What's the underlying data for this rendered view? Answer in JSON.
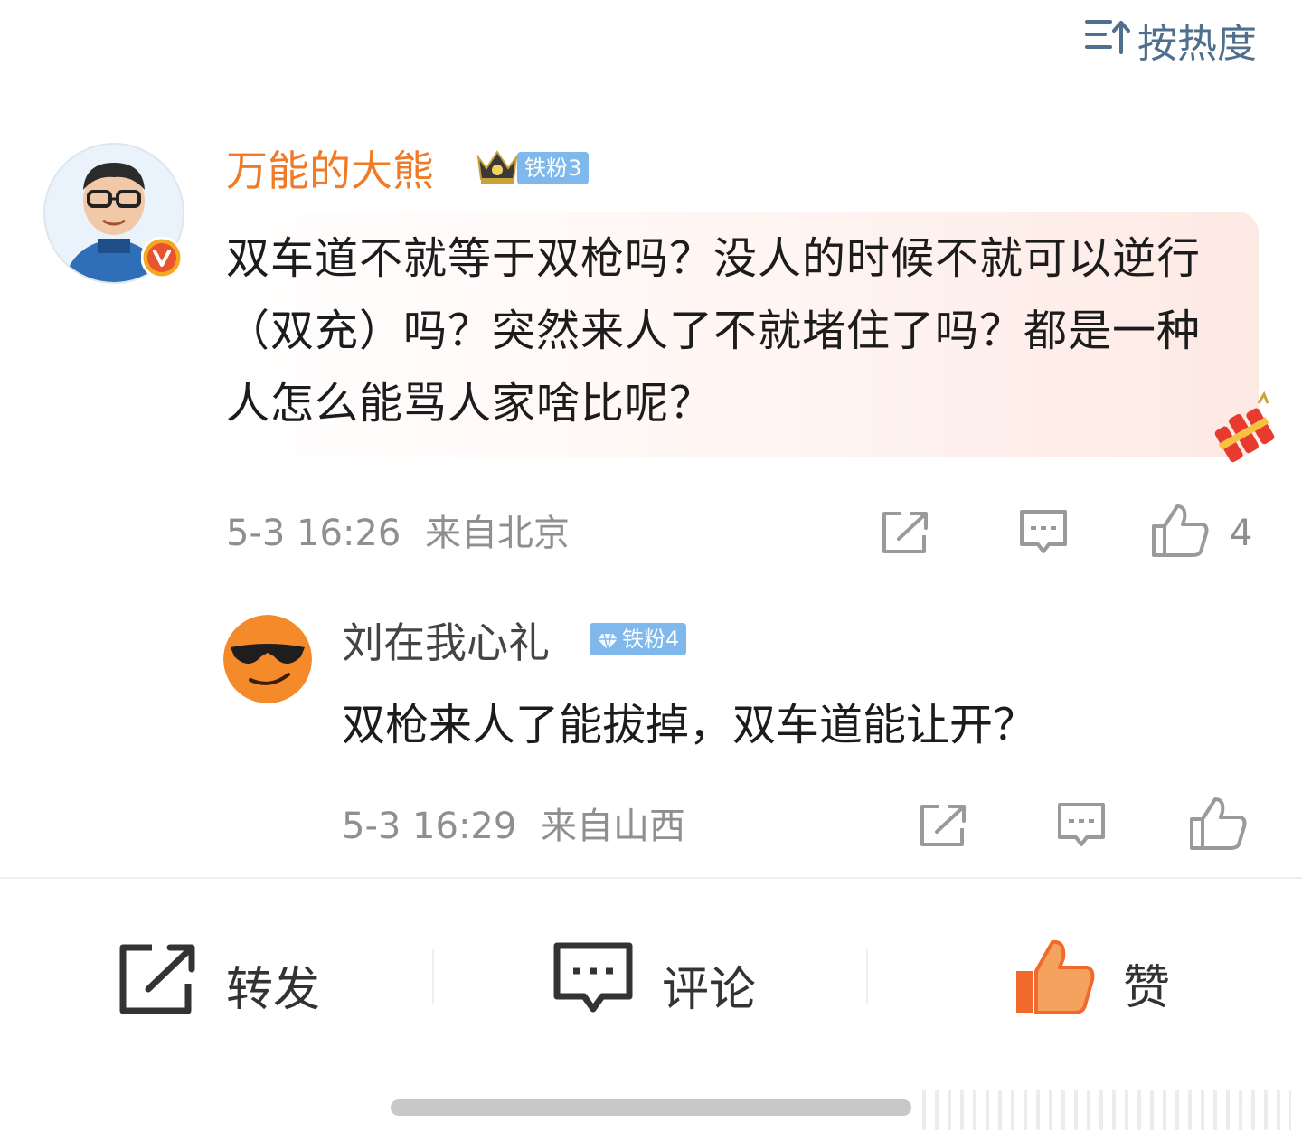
{
  "sort": {
    "label": "按热度",
    "icon": "sort-icon"
  },
  "comment": {
    "username": "万能的大熊",
    "fan_badge": "铁粉3",
    "text": "双车道不就等于双枪吗？没人的时候不就可以逆行（双充）吗？突然来人了不就堵住了吗？都是一种人怎么能骂人家啥比呢？",
    "time": "5-3 16:26",
    "location": "来自北京",
    "like_count": "4",
    "verified_icon": "v-badge-icon",
    "username_color": "#f07a25"
  },
  "reply": {
    "username": "刘在我心礼",
    "fan_badge": "铁粉4",
    "text": "双枪来人了能拔掉，双车道能让开？",
    "time": "5-3 16:29",
    "location": "来自山西"
  },
  "actions": {
    "repost": "转发",
    "comment": "评论",
    "like": "赞",
    "like_color": "#f26a2b"
  },
  "colors": {
    "fan_badge": "#7eb8ec",
    "meta": "#8f8f8f",
    "sort": "#4f6f8d"
  }
}
